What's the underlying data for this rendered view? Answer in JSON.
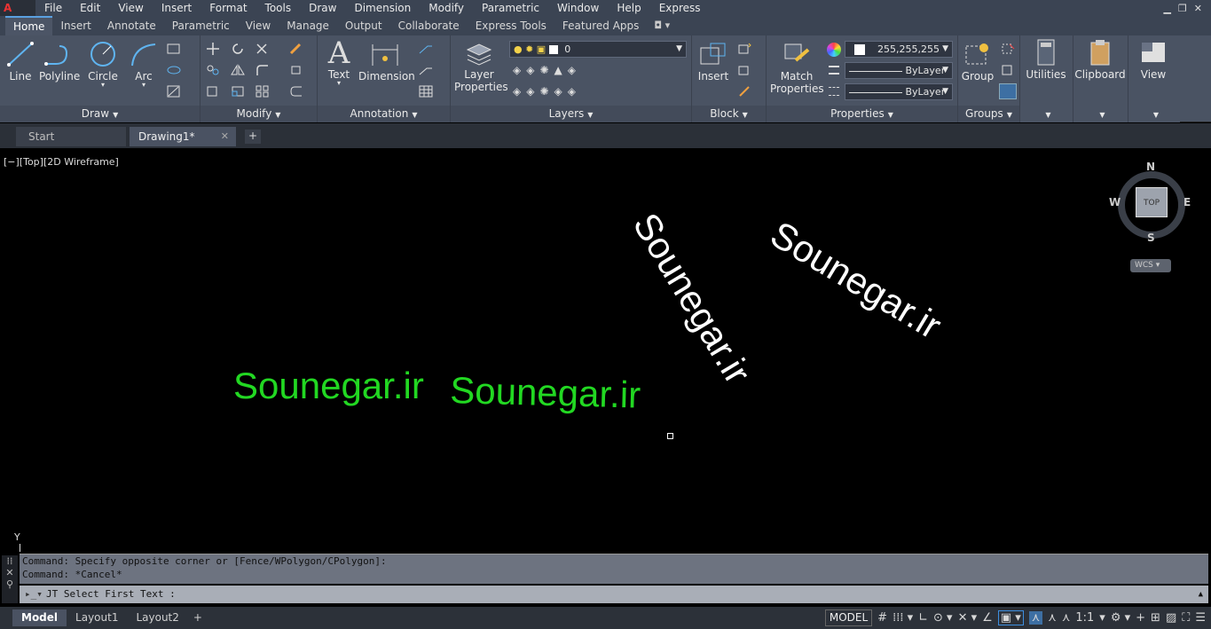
{
  "menu": [
    "File",
    "Edit",
    "View",
    "Insert",
    "Format",
    "Tools",
    "Draw",
    "Dimension",
    "Modify",
    "Parametric",
    "Window",
    "Help",
    "Express"
  ],
  "ribbon_tabs": [
    "Home",
    "Insert",
    "Annotate",
    "Parametric",
    "View",
    "Manage",
    "Output",
    "Collaborate",
    "Express Tools",
    "Featured Apps"
  ],
  "panels": {
    "draw": {
      "title": "Draw",
      "tools": [
        "Line",
        "Polyline",
        "Circle",
        "Arc"
      ]
    },
    "modify": {
      "title": "Modify"
    },
    "annotation": {
      "title": "Annotation",
      "tools": [
        "Text",
        "Dimension"
      ]
    },
    "layers": {
      "title": "Layers",
      "layer_props_line1": "Layer",
      "layer_props_line2": "Properties",
      "current_layer": "0"
    },
    "block": {
      "title": "Block",
      "insert": "Insert"
    },
    "properties": {
      "title": "Properties",
      "match_line1": "Match",
      "match_line2": "Properties",
      "color": "255,255,255",
      "linetype": "ByLayer",
      "lineweight": "ByLayer"
    },
    "groups": {
      "title": "Groups",
      "group": "Group"
    },
    "utilities": {
      "label": "Utilities"
    },
    "clipboard": {
      "label": "Clipboard"
    },
    "view": {
      "label": "View"
    }
  },
  "file_tabs": [
    "Start",
    "Drawing1*"
  ],
  "viewport_label": "[−][Top][2D Wireframe]",
  "drawing_texts": {
    "green1": "Sounegar.ir",
    "green2": "Sounegar.ir",
    "white1": "Sounegar.ir",
    "white2": "Sounegar.ir"
  },
  "viewcube": {
    "n": "N",
    "s": "S",
    "e": "E",
    "w": "W",
    "top": "TOP",
    "wcs": "WCS"
  },
  "command": {
    "history1": "Command: Specify opposite corner or [Fence/WPolygon/CPolygon]:",
    "history2": "Command: *Cancel*",
    "prompt": "JT Select First Text :"
  },
  "layout_tabs": [
    "Model",
    "Layout1",
    "Layout2"
  ],
  "status": {
    "model": "MODEL",
    "scale": "1:1"
  }
}
